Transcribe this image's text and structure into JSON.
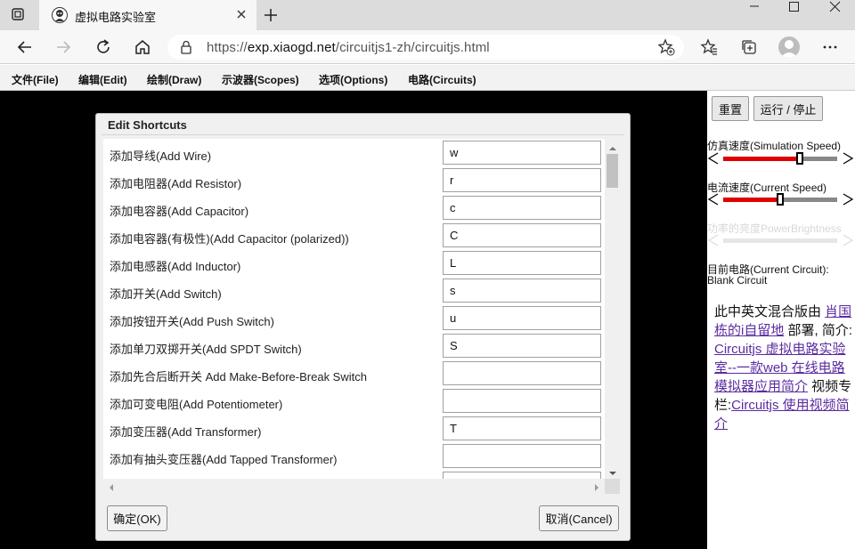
{
  "browser": {
    "tab_title": "虚拟电路实验室",
    "url_prefix": "https://",
    "url_host": "exp.xiaogd.net",
    "url_path": "/circuitjs1-zh/circuitjs.html"
  },
  "menu": {
    "items": [
      "文件(File)",
      "编辑(Edit)",
      "绘制(Draw)",
      "示波器(Scopes)",
      "选项(Options)",
      "电路(Circuits)"
    ]
  },
  "sidebar": {
    "reset_label": "重置",
    "run_stop_label": "运行 / 停止",
    "sim_speed_label": "仿真速度(Simulation Speed)",
    "sim_speed_value": 0.67,
    "current_speed_label": "电流速度(Current Speed)",
    "current_speed_value": 0.5,
    "power_label": "功率的亮度PowerBrightness",
    "power_value": 0.0,
    "circuit_label": "目前电路(Current Circuit):",
    "circuit_name": "Blank Circuit",
    "note": {
      "t1": "此中英文混合版由 ",
      "link1": "肖国栋的i自留地",
      "t2": " 部署, 简介: ",
      "link2": "Circuitjs 虚拟电路实验室--一款web 在线电路模拟器应用简介",
      "t3": " 视频专栏:",
      "link3": "Circuitjs 使用视频简介"
    }
  },
  "dialog": {
    "title": "Edit Shortcuts",
    "ok_label": "确定(OK)",
    "cancel_label": "取消(Cancel)",
    "rows": [
      {
        "label": "添加导线(Add Wire)",
        "key": "w"
      },
      {
        "label": "添加电阻器(Add Resistor)",
        "key": "r"
      },
      {
        "label": "添加电容器(Add Capacitor)",
        "key": "c"
      },
      {
        "label": "添加电容器(有极性)(Add Capacitor (polarized))",
        "key": "C"
      },
      {
        "label": "添加电感器(Add Inductor)",
        "key": "L"
      },
      {
        "label": "添加开关(Add Switch)",
        "key": "s"
      },
      {
        "label": "添加按钮开关(Add Push Switch)",
        "key": "u"
      },
      {
        "label": "添加单刀双掷开关(Add SPDT Switch)",
        "key": "S"
      },
      {
        "label": "添加先合后断开关 Add Make-Before-Break Switch",
        "key": ""
      },
      {
        "label": "添加可变电阻(Add Potentiometer)",
        "key": ""
      },
      {
        "label": "添加变压器(Add Transformer)",
        "key": "T"
      },
      {
        "label": "添加有抽头变压器(Add Tapped Transformer)",
        "key": ""
      },
      {
        "label": "",
        "key": ""
      }
    ]
  }
}
